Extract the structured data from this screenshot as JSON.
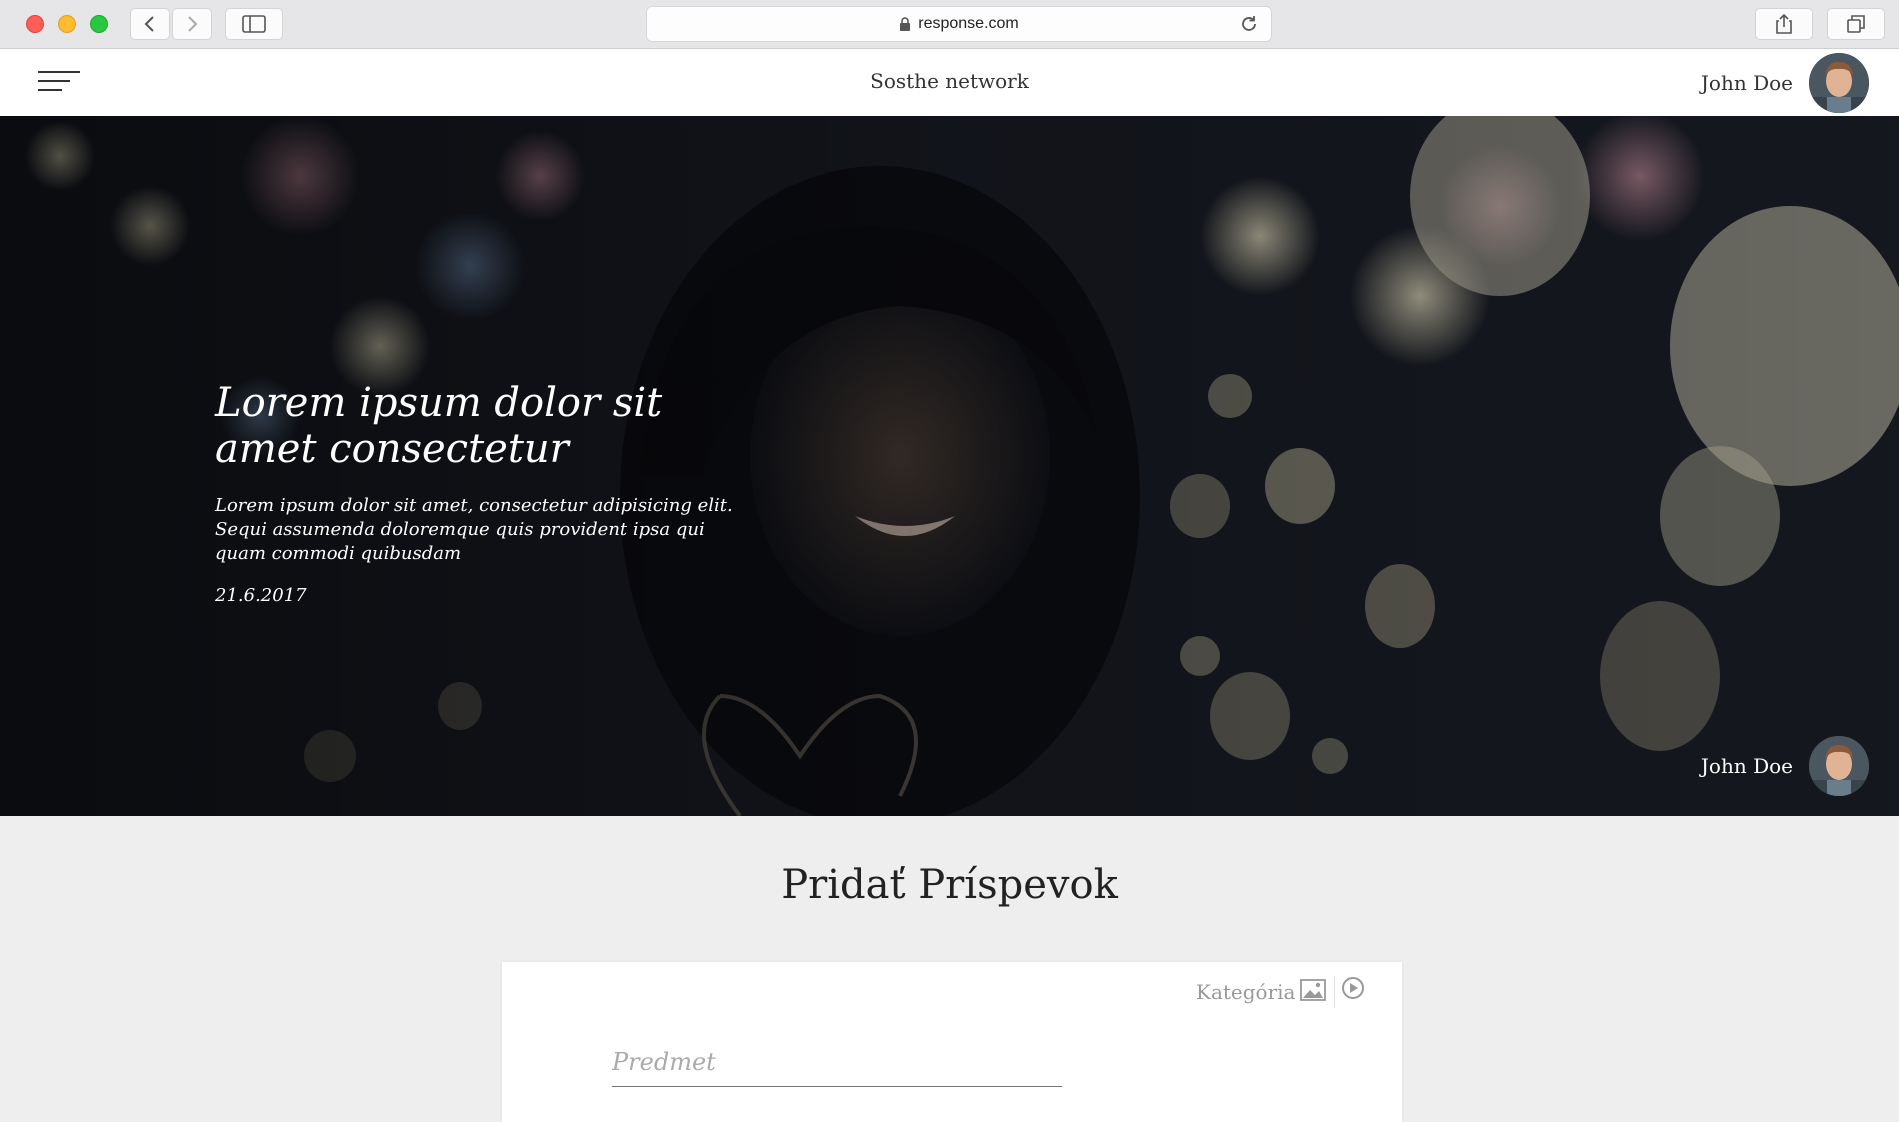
{
  "browser": {
    "url": "response.com",
    "icons": {
      "back": "chevron-left-icon",
      "forward": "chevron-right-icon",
      "sidebar": "sidebar-icon",
      "lock": "lock-icon",
      "reload": "reload-icon",
      "share": "share-icon",
      "tabs": "tabs-icon"
    }
  },
  "navbar": {
    "menu_icon": "hamburger-menu-icon",
    "brand": "Sosthe network",
    "user_name": "John Doe"
  },
  "hero": {
    "title": "Lorem ipsum dolor sit amet consectetur",
    "subtitle": "Lorem ipsum dolor sit amet, consectetur adipisicing elit. Sequi assumenda doloremque quis provident ipsa qui quam commodi quibusdam",
    "date": "21.6.2017",
    "author_name": "John Doe"
  },
  "compose": {
    "heading": "Pridať Príspevok",
    "category_label": "Kategória",
    "subject_placeholder": "Predmet",
    "subject_value": "",
    "icons": {
      "image": "image-icon",
      "video": "play-circle-icon"
    }
  },
  "colors": {
    "chrome_bg": "#e6e5e7",
    "page_bg": "#eeeeee",
    "hero_overlay": "#101218",
    "text_dark": "#333333"
  }
}
